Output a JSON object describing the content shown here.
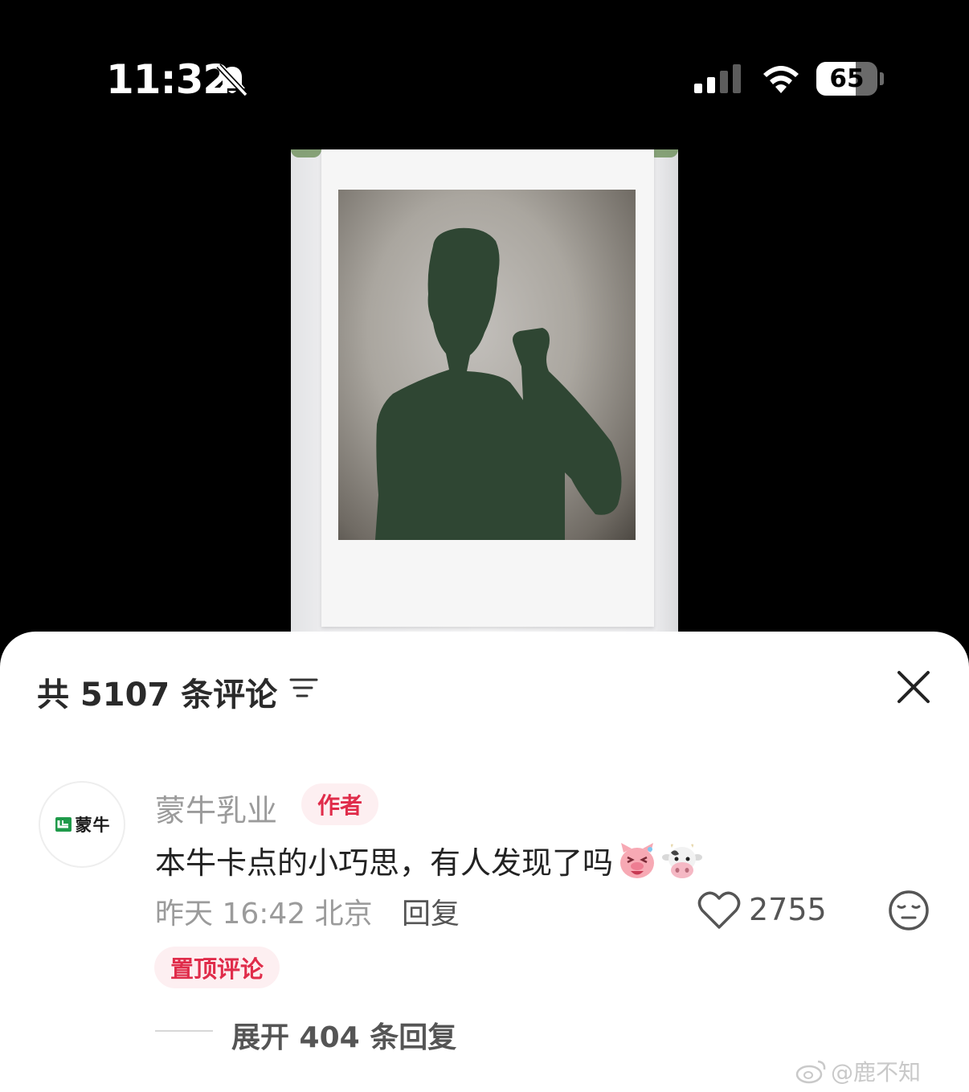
{
  "status_bar": {
    "time": "11:32",
    "battery_level": "65",
    "icons": [
      "bell-slash-icon",
      "signal-icon",
      "wifi-icon",
      "battery-icon"
    ]
  },
  "sheet": {
    "title": "共 5107 条评论",
    "filter_icon": "filter-icon",
    "close_icon": "close-icon"
  },
  "comment": {
    "avatar_text": "蒙牛",
    "username": "蒙牛乳业",
    "author_badge": "作者",
    "text": "本牛卡点的小巧思，有人发现了吗",
    "emojis": [
      "laughing-pig-emoji",
      "cow-emoji"
    ],
    "meta": "昨天 16:42 北京",
    "reply_label": "回复",
    "like_count": "2755",
    "pinned_label": "置顶评论",
    "expand_label": "展开 404 条回复"
  },
  "watermark": {
    "text": "@鹿不知"
  },
  "colors": {
    "accent": "#e02c4a",
    "badge_bg": "#fdeff1",
    "silhouette": "#2f4633"
  }
}
